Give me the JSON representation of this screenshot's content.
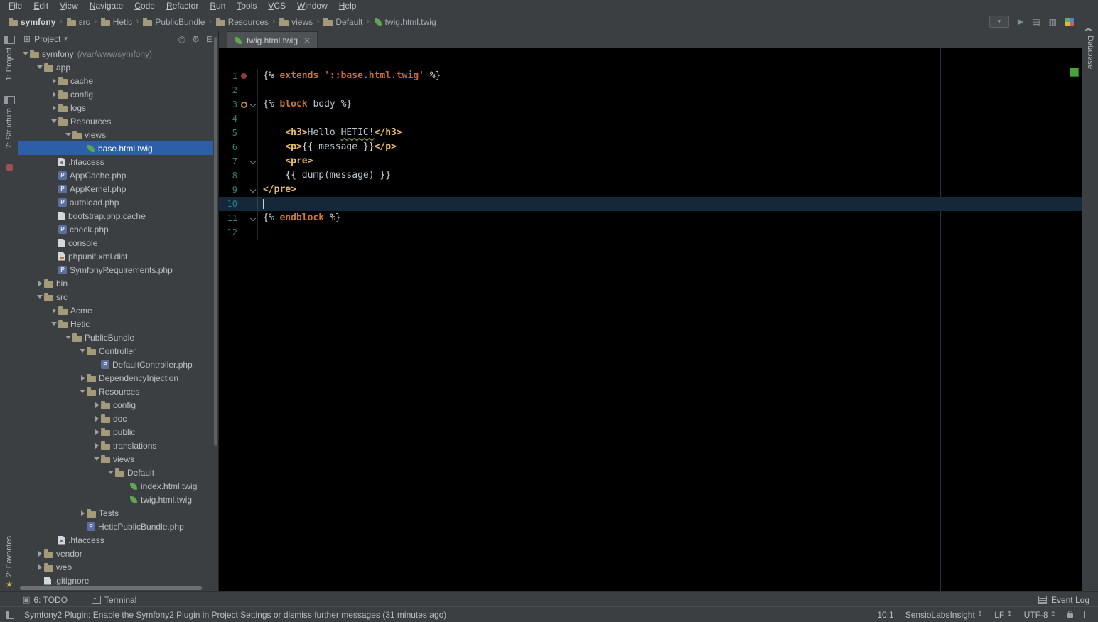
{
  "menu_bar": {
    "items": [
      "File",
      "Edit",
      "View",
      "Navigate",
      "Code",
      "Refactor",
      "Run",
      "Tools",
      "VCS",
      "Window",
      "Help"
    ]
  },
  "toolbar": {
    "separator": "›",
    "breadcrumbs": [
      {
        "label": "symfony",
        "icon": "folder",
        "bold": true
      },
      {
        "label": "src",
        "icon": "folder"
      },
      {
        "label": "Hetic",
        "icon": "folder"
      },
      {
        "label": "PublicBundle",
        "icon": "folder"
      },
      {
        "label": "Resources",
        "icon": "folder"
      },
      {
        "label": "views",
        "icon": "folder"
      },
      {
        "label": "Default",
        "icon": "folder"
      },
      {
        "label": "twig.html.twig",
        "icon": "twig"
      }
    ]
  },
  "left_stripe": {
    "top": [
      "1: Project",
      "7: Structure"
    ],
    "bottom": "2: Favorites"
  },
  "right_stripe": {
    "top": "Database"
  },
  "project": {
    "header": {
      "title": "Project"
    },
    "tree": [
      {
        "label": "symfony",
        "suffix": "(/var/www/symfony)",
        "depth": 0,
        "icon": "folder",
        "arrow": "down"
      },
      {
        "label": "app",
        "depth": 1,
        "icon": "folder",
        "arrow": "down"
      },
      {
        "label": "cache",
        "depth": 2,
        "icon": "folder",
        "arrow": "right"
      },
      {
        "label": "config",
        "depth": 2,
        "icon": "folder",
        "arrow": "right"
      },
      {
        "label": "logs",
        "depth": 2,
        "icon": "folder",
        "arrow": "right"
      },
      {
        "label": "Resources",
        "depth": 2,
        "icon": "folder",
        "arrow": "down"
      },
      {
        "label": "views",
        "depth": 3,
        "icon": "folder",
        "arrow": "down"
      },
      {
        "label": "base.html.twig",
        "depth": 4,
        "icon": "twig",
        "selected": true
      },
      {
        "label": ".htaccess",
        "depth": 2,
        "icon": "htaccess"
      },
      {
        "label": "AppCache.php",
        "depth": 2,
        "icon": "php"
      },
      {
        "label": "AppKernel.php",
        "depth": 2,
        "icon": "php"
      },
      {
        "label": "autoload.php",
        "depth": 2,
        "icon": "php"
      },
      {
        "label": "bootstrap.php.cache",
        "depth": 2,
        "icon": "file"
      },
      {
        "label": "check.php",
        "depth": 2,
        "icon": "php"
      },
      {
        "label": "console",
        "depth": 2,
        "icon": "file"
      },
      {
        "label": "phpunit.xml.dist",
        "depth": 2,
        "icon": "xml"
      },
      {
        "label": "SymfonyRequirements.php",
        "depth": 2,
        "icon": "php"
      },
      {
        "label": "bin",
        "depth": 1,
        "icon": "folder",
        "arrow": "right"
      },
      {
        "label": "src",
        "depth": 1,
        "icon": "folder",
        "arrow": "down"
      },
      {
        "label": "Acme",
        "depth": 2,
        "icon": "folder",
        "arrow": "right"
      },
      {
        "label": "Hetic",
        "depth": 2,
        "icon": "folder",
        "arrow": "down"
      },
      {
        "label": "PublicBundle",
        "depth": 3,
        "icon": "folder",
        "arrow": "down"
      },
      {
        "label": "Controller",
        "depth": 4,
        "icon": "folder",
        "arrow": "down"
      },
      {
        "label": "DefaultController.php",
        "depth": 5,
        "icon": "php"
      },
      {
        "label": "DependencyInjection",
        "depth": 4,
        "icon": "folder",
        "arrow": "right"
      },
      {
        "label": "Resources",
        "depth": 4,
        "icon": "folder",
        "arrow": "down"
      },
      {
        "label": "config",
        "depth": 5,
        "icon": "folder",
        "arrow": "right"
      },
      {
        "label": "doc",
        "depth": 5,
        "icon": "folder",
        "arrow": "right"
      },
      {
        "label": "public",
        "depth": 5,
        "icon": "folder",
        "arrow": "right"
      },
      {
        "label": "translations",
        "depth": 5,
        "icon": "folder",
        "arrow": "right"
      },
      {
        "label": "views",
        "depth": 5,
        "icon": "folder",
        "arrow": "down"
      },
      {
        "label": "Default",
        "depth": 6,
        "icon": "folder",
        "arrow": "down"
      },
      {
        "label": "index.html.twig",
        "depth": 7,
        "icon": "twig"
      },
      {
        "label": "twig.html.twig",
        "depth": 7,
        "icon": "twig"
      },
      {
        "label": "Tests",
        "depth": 4,
        "icon": "folder",
        "arrow": "right"
      },
      {
        "label": "HeticPublicBundle.php",
        "depth": 4,
        "icon": "php"
      },
      {
        "label": ".htaccess",
        "depth": 2,
        "icon": "htaccess"
      },
      {
        "label": "vendor",
        "depth": 1,
        "icon": "folder",
        "arrow": "right"
      },
      {
        "label": "web",
        "depth": 1,
        "icon": "folder",
        "arrow": "right"
      },
      {
        "label": ".gitignore",
        "depth": 1,
        "icon": "file"
      }
    ]
  },
  "editor": {
    "tab": {
      "label": "twig.html.twig"
    },
    "active_line": 10,
    "lines": [
      {
        "num": 1,
        "mark": "red",
        "tokens": [
          [
            "tw",
            "{% "
          ],
          [
            "kw",
            "extends "
          ],
          [
            "str",
            "'::base.html.twig'"
          ],
          [
            "tw",
            " %}"
          ]
        ]
      },
      {
        "num": 2,
        "tokens": []
      },
      {
        "num": 3,
        "mark": "orange",
        "fold": true,
        "tokens": [
          [
            "tw",
            "{% "
          ],
          [
            "kw",
            "block"
          ],
          [
            "pl",
            " body "
          ],
          [
            "tw",
            "%}"
          ]
        ]
      },
      {
        "num": 4,
        "tokens": []
      },
      {
        "num": 5,
        "tokens": [
          [
            "pl",
            "    "
          ],
          [
            "tag",
            "<h3>"
          ],
          [
            "pl",
            "Hello "
          ],
          [
            "typo",
            "HETIC!"
          ],
          [
            "tag",
            "</h3>"
          ]
        ]
      },
      {
        "num": 6,
        "tokens": [
          [
            "pl",
            "    "
          ],
          [
            "tag",
            "<p>"
          ],
          [
            "tw",
            "{{ "
          ],
          [
            "pl",
            "message"
          ],
          [
            "tw",
            " }}"
          ],
          [
            "tag",
            "</p>"
          ]
        ]
      },
      {
        "num": 7,
        "fold": true,
        "tokens": [
          [
            "pl",
            "    "
          ],
          [
            "tag",
            "<pre>"
          ]
        ]
      },
      {
        "num": 8,
        "tokens": [
          [
            "pl",
            "    "
          ],
          [
            "tw",
            "{{ "
          ],
          [
            "pl",
            "dump(message)"
          ],
          [
            "tw",
            " }}"
          ]
        ]
      },
      {
        "num": 9,
        "fold": true,
        "tokens": [
          [
            "tag",
            "</pre>"
          ]
        ]
      },
      {
        "num": 10,
        "tokens": []
      },
      {
        "num": 11,
        "fold": true,
        "tokens": [
          [
            "tw",
            "{% "
          ],
          [
            "kw",
            "endblock"
          ],
          [
            "pl",
            " "
          ],
          [
            "tw",
            "%}"
          ]
        ]
      },
      {
        "num": 12,
        "tokens": []
      }
    ]
  },
  "bottom_bar": {
    "left": [
      "6: TODO",
      "Terminal"
    ],
    "right": "Event Log"
  },
  "status_bar": {
    "message": "Symfony2 Plugin: Enable the Symfony2 Plugin in Project Settings or dismiss further messages (31 minutes ago)",
    "caret": "10:1",
    "insight": "SensioLabsInsight",
    "line_sep": "LF",
    "encoding": "UTF-8"
  }
}
